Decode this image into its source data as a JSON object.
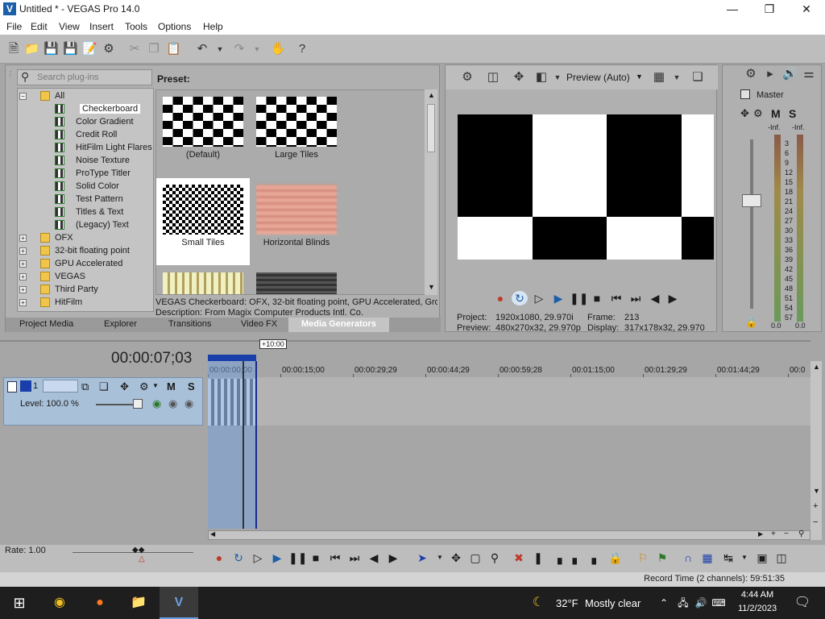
{
  "window": {
    "title": "Untitled * - VEGAS Pro 14.0"
  },
  "menu": [
    "File",
    "Edit",
    "View",
    "Insert",
    "Tools",
    "Options",
    "Help"
  ],
  "generators": {
    "search_placeholder": "Search plug-ins",
    "preset_label": "Preset:",
    "tree": [
      {
        "label": "All",
        "type": "folder",
        "expanded": true,
        "level": 0
      },
      {
        "label": "Checkerboard",
        "type": "item",
        "level": 1,
        "selected": true
      },
      {
        "label": "Color Gradient",
        "type": "item",
        "level": 1
      },
      {
        "label": "Credit Roll",
        "type": "item",
        "level": 1
      },
      {
        "label": "HitFilm Light Flares",
        "type": "item",
        "level": 1
      },
      {
        "label": "Noise Texture",
        "type": "item",
        "level": 1
      },
      {
        "label": "ProType Titler",
        "type": "item",
        "level": 1
      },
      {
        "label": "Solid Color",
        "type": "item",
        "level": 1
      },
      {
        "label": "Test Pattern",
        "type": "item",
        "level": 1
      },
      {
        "label": "Titles & Text",
        "type": "item",
        "level": 1
      },
      {
        "label": "(Legacy) Text",
        "type": "item",
        "level": 1
      },
      {
        "label": "OFX",
        "type": "folder",
        "level": 0
      },
      {
        "label": "32-bit floating point",
        "type": "folder",
        "level": 0
      },
      {
        "label": "GPU Accelerated",
        "type": "folder",
        "level": 0
      },
      {
        "label": "VEGAS",
        "type": "folder",
        "level": 0
      },
      {
        "label": "Third Party",
        "type": "folder",
        "level": 0
      },
      {
        "label": "HitFilm",
        "type": "folder",
        "level": 0
      }
    ],
    "presets": [
      {
        "label": "(Default)",
        "selected": false
      },
      {
        "label": "Large Tiles",
        "selected": false
      },
      {
        "label": "Small Tiles",
        "selected": true
      },
      {
        "label": "Horizontal Blinds",
        "selected": false
      }
    ],
    "description_line1": "VEGAS Checkerboard: OFX, 32-bit floating point, GPU Accelerated, Grou",
    "description_line2": "Description: From Magix Computer Products Intl. Co.",
    "tabs": [
      "Project Media",
      "Explorer",
      "Transitions",
      "Video FX",
      "Media Generators"
    ],
    "active_tab": "Media Generators"
  },
  "preview": {
    "quality": "Preview (Auto)",
    "project_label": "Project:",
    "project_value": "1920x1080, 29.970i",
    "frame_label": "Frame:",
    "frame_value": "213",
    "preview_label": "Preview:",
    "preview_value": "480x270x32, 29.970p",
    "display_label": "Display:",
    "display_value": "317x178x32, 29.970"
  },
  "master": {
    "title": "Master",
    "m": "M",
    "s": "S",
    "inf_l": "-Inf.",
    "inf_r": "-Inf.",
    "scale": [
      "3",
      "6",
      "9",
      "12",
      "15",
      "18",
      "21",
      "24",
      "27",
      "30",
      "33",
      "36",
      "39",
      "42",
      "45",
      "48",
      "51",
      "54",
      "57"
    ],
    "level_l": "0.0",
    "level_r": "0.0"
  },
  "timeline": {
    "time": "00:00:07;03",
    "marker": "+10:00",
    "track_number": "1",
    "level_label": "Level: 100.0 %",
    "m": "M",
    "s": "S",
    "ruler": [
      "00:00:00;00",
      "00:00:15;00",
      "00:00:29;29",
      "00:00:44;29",
      "00:00:59;28",
      "00:01:15;00",
      "00:01:29;29",
      "00:01:44;29",
      "00:0"
    ]
  },
  "bottom": {
    "rate": "Rate: 1.00",
    "record_time": "Record Time (2 channels): 59:51:35"
  },
  "taskbar": {
    "weather_temp": "32°F",
    "weather_desc": "Mostly clear",
    "time": "4:44 AM",
    "date": "11/2/2023"
  }
}
